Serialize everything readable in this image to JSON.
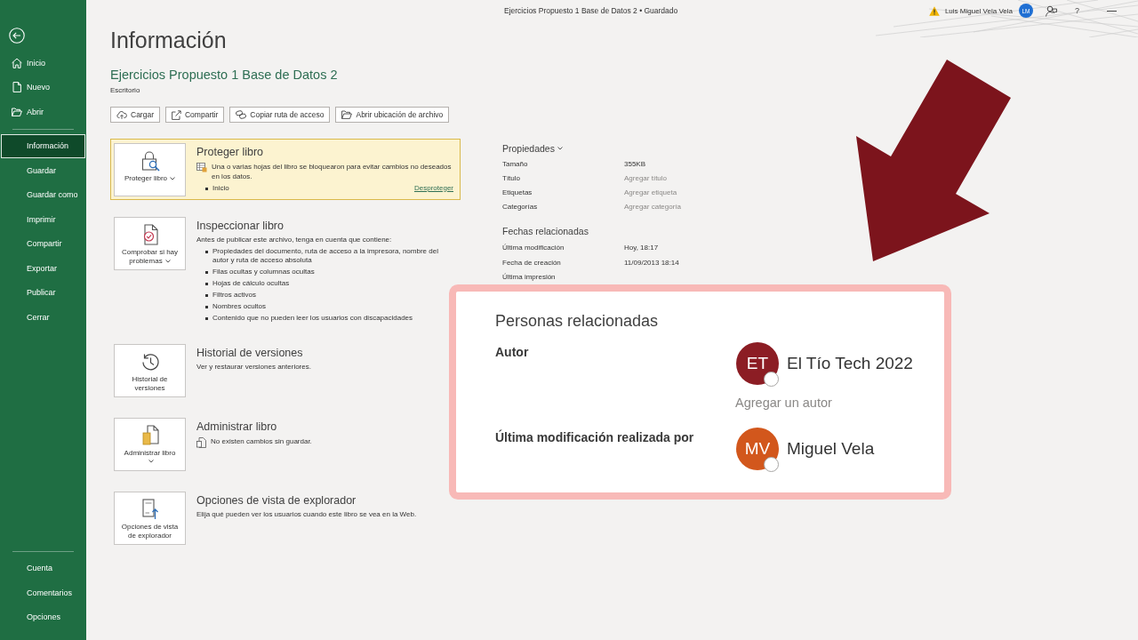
{
  "window": {
    "title": "Ejercicios Propuesto 1 Base de Datos 2 • Guardado",
    "user_name": "Luis Miguel Vela Vela",
    "user_initials": "LM",
    "help": "?"
  },
  "sidebar": {
    "top_items": [
      {
        "label": "Inicio",
        "selected": false
      },
      {
        "label": "Nuevo",
        "selected": false
      },
      {
        "label": "Abrir",
        "selected": false
      }
    ],
    "items": [
      {
        "label": "Información",
        "selected": true
      },
      {
        "label": "Guardar",
        "selected": false
      },
      {
        "label": "Guardar como",
        "selected": false
      },
      {
        "label": "Imprimir",
        "selected": false
      },
      {
        "label": "Compartir",
        "selected": false
      },
      {
        "label": "Exportar",
        "selected": false
      },
      {
        "label": "Publicar",
        "selected": false
      },
      {
        "label": "Cerrar",
        "selected": false
      }
    ],
    "bottom_items": [
      {
        "label": "Cuenta",
        "selected": false
      },
      {
        "label": "Comentarios",
        "selected": false
      },
      {
        "label": "Opciones",
        "selected": false
      }
    ]
  },
  "page_title": "Información",
  "file": {
    "name": "Ejercicios Propuesto 1 Base de Datos 2",
    "location": "Escritorio"
  },
  "actions": [
    "Cargar",
    "Compartir",
    "Copiar ruta de acceso",
    "Abrir ubicación de archivo"
  ],
  "sections": [
    {
      "kind": "protect",
      "button": "Proteger libro",
      "dropdown": true,
      "title": "Proteger libro",
      "notice": "Una o varias hojas del libro se bloquearon para evitar cambios no deseados en los datos.",
      "bullets": [
        "Inicio"
      ],
      "link": "Desproteger"
    },
    {
      "kind": "inspect",
      "button": "Comprobar si hay problemas",
      "dropdown": true,
      "title": "Inspeccionar libro",
      "description": "Antes de publicar este archivo, tenga en cuenta que contiene:",
      "bullets": [
        "Propiedades del documento, ruta de acceso a la impresora, nombre del autor y ruta de acceso absoluta",
        "Filas ocultas y columnas ocultas",
        "Hojas de cálculo ocultas",
        "Filtros activos",
        "Nombres ocultos",
        "Contenido que no pueden leer los usuarios con discapacidades"
      ]
    },
    {
      "kind": "history",
      "button": "Historial de versiones",
      "dropdown": false,
      "title": "Historial de versiones",
      "description": "Ver y restaurar versiones anteriores."
    },
    {
      "kind": "manage",
      "button": "Administrar libro",
      "dropdown": true,
      "title": "Administrar libro",
      "notice": "No existen cambios sin guardar."
    },
    {
      "kind": "browser",
      "button": "Opciones de vista de explorador",
      "dropdown": false,
      "title": "Opciones de vista de explorador",
      "description": "Elija qué pueden ver los usuarios cuando este libro se vea en la Web."
    }
  ],
  "properties": {
    "title": "Propiedades",
    "rows": [
      {
        "label": "Tamaño",
        "value": "355KB"
      },
      {
        "label": "Título",
        "placeholder": "Agregar título"
      },
      {
        "label": "Etiquetas",
        "placeholder": "Agregar etiqueta"
      },
      {
        "label": "Categorías",
        "placeholder": "Agregar categoría"
      }
    ]
  },
  "related_dates": {
    "title": "Fechas relacionadas",
    "rows": [
      {
        "label": "Última modificación",
        "value": "Hoy, 18:17"
      },
      {
        "label": "Fecha de creación",
        "value": "11/09/2013 18:14"
      },
      {
        "label": "Última impresión"
      }
    ]
  },
  "related_people": {
    "title": "Personas relacionadas",
    "author_label": "Autor",
    "authors": [
      {
        "initials": "ET",
        "name": "El Tío Tech 2022",
        "color": "#8c1d24"
      }
    ],
    "add_author_placeholder": "Agregar un autor",
    "modified_label": "Última modificación realizada por",
    "modified_by": [
      {
        "initials": "MV",
        "name": "Miguel Vela",
        "color": "#d2571c"
      }
    ]
  }
}
